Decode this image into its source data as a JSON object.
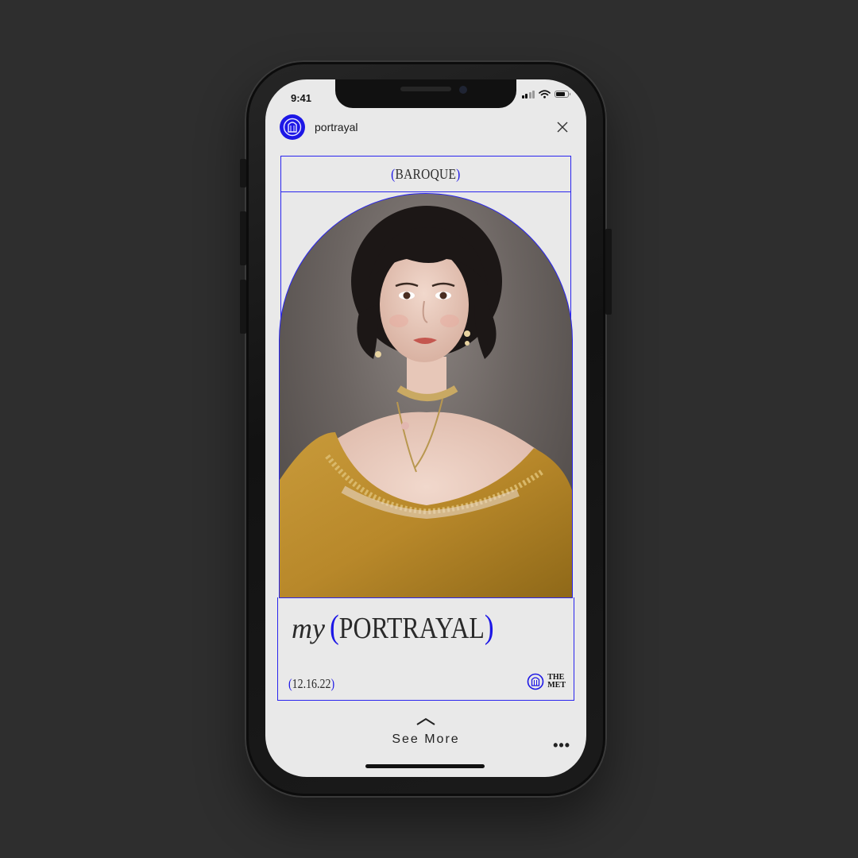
{
  "status_bar": {
    "time": "9:41",
    "icons": [
      "signal-icon",
      "wifi-icon",
      "battery-icon"
    ]
  },
  "header": {
    "account_name": "portrayal",
    "avatar_icon": "portrayal-logo-icon",
    "close_icon": "close-icon"
  },
  "card": {
    "style_open": "(",
    "style_label": "BAROQUE",
    "style_close": ")",
    "title_prefix": "my",
    "title_open": "(",
    "title_main": "PORTRAYAL",
    "title_close": ")",
    "date_open": "(",
    "date": "12.16.22",
    "date_close": ")",
    "partner_line1": "THE",
    "partner_line2": "MET"
  },
  "footer": {
    "see_more_label": "See More",
    "more_icon": "more-options-icon",
    "chevron_icon": "chevron-up-icon"
  },
  "colors": {
    "accent": "#1d17e6",
    "screen_bg": "#e9e9e9",
    "page_bg": "#2e2e2e",
    "dress": "#b8882a"
  }
}
